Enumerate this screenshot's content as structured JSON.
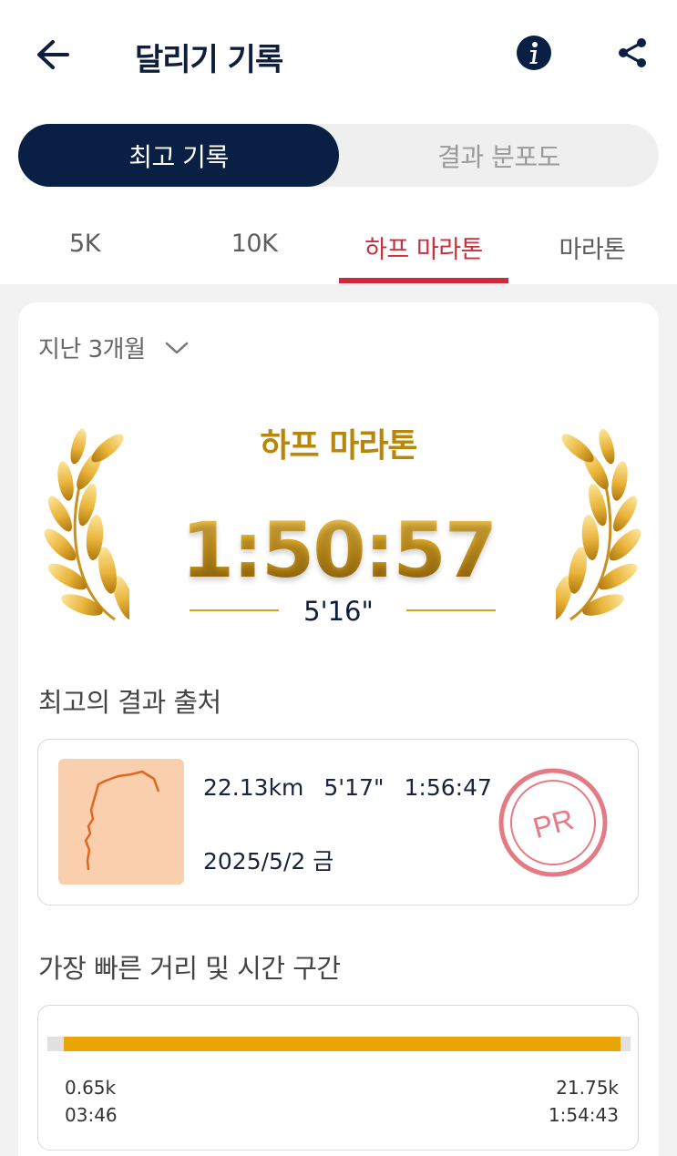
{
  "header": {
    "title": "달리기 기록"
  },
  "segments": {
    "active": "최고 기록",
    "inactive": "결과 분포도"
  },
  "tabs": [
    "5K",
    "10K",
    "하프 마라톤",
    "마라톤"
  ],
  "active_tab": "하프 마라톤",
  "period": "지난 3개월",
  "best": {
    "distance_label": "하프 마라톤",
    "time": "1:50:57",
    "pace": "5'16\""
  },
  "source_section": {
    "title": "최고의 결과 출처",
    "distance": "22.13km",
    "pace": "5'17\"",
    "duration": "1:56:47",
    "date": "2025/5/2 금",
    "badge": "PR"
  },
  "fastest_section": {
    "title": "가장 빠른 거리 및 시간 구간",
    "start_distance": "0.65k",
    "start_time": "03:46",
    "end_distance": "21.75k",
    "end_time": "1:54:43"
  },
  "colors": {
    "navy": "#0a1f44",
    "accent_red": "#d2283b",
    "gold": "#d5a41a",
    "bar_gold": "#e8a505",
    "pr_pink": "#e57a85",
    "map_bg": "#f9cfae",
    "route_orange": "#e2661f"
  },
  "icons": {
    "back": "arrow-left-icon",
    "info": "info-circle-icon",
    "share": "share-icon",
    "dropdown": "chevron-down-icon",
    "wreath": "laurel-wreath-icon"
  }
}
